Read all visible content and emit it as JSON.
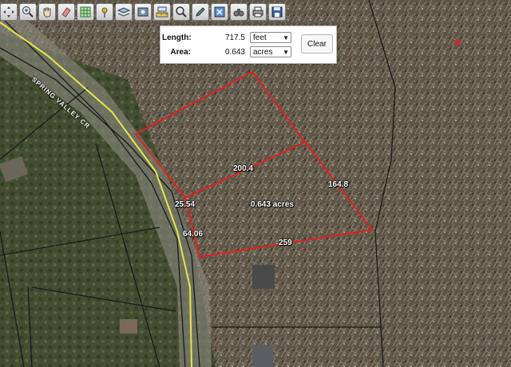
{
  "toolbar": {
    "tools": [
      "pan-icon",
      "zoom-in-icon",
      "hand-icon",
      "eraser-icon",
      "grid-select-icon",
      "pin-icon",
      "layers-icon",
      "photo-icon",
      "measure-icon",
      "search-zoom-icon",
      "pencil-icon",
      "zoom-extent-icon",
      "binoculars-icon",
      "print-icon",
      "save-icon"
    ]
  },
  "measure": {
    "length_label": "Length:",
    "length_value": "717.5",
    "length_unit": "feet",
    "area_label": "Area:",
    "area_value": "0.643",
    "area_unit": "acres",
    "clear_label": "Clear"
  },
  "map": {
    "street_name": "SPRING VALLEY CR",
    "segments": {
      "top": "200.4",
      "right": "164.8",
      "left_upper": "25.54",
      "left_lower": "64.06",
      "bottom": "259"
    },
    "area_label": "0.643 acres",
    "colors": {
      "parcel_outline": "#e02020",
      "road_line": "#e6e64a",
      "parcel_lines": "#1a1a1a"
    }
  }
}
